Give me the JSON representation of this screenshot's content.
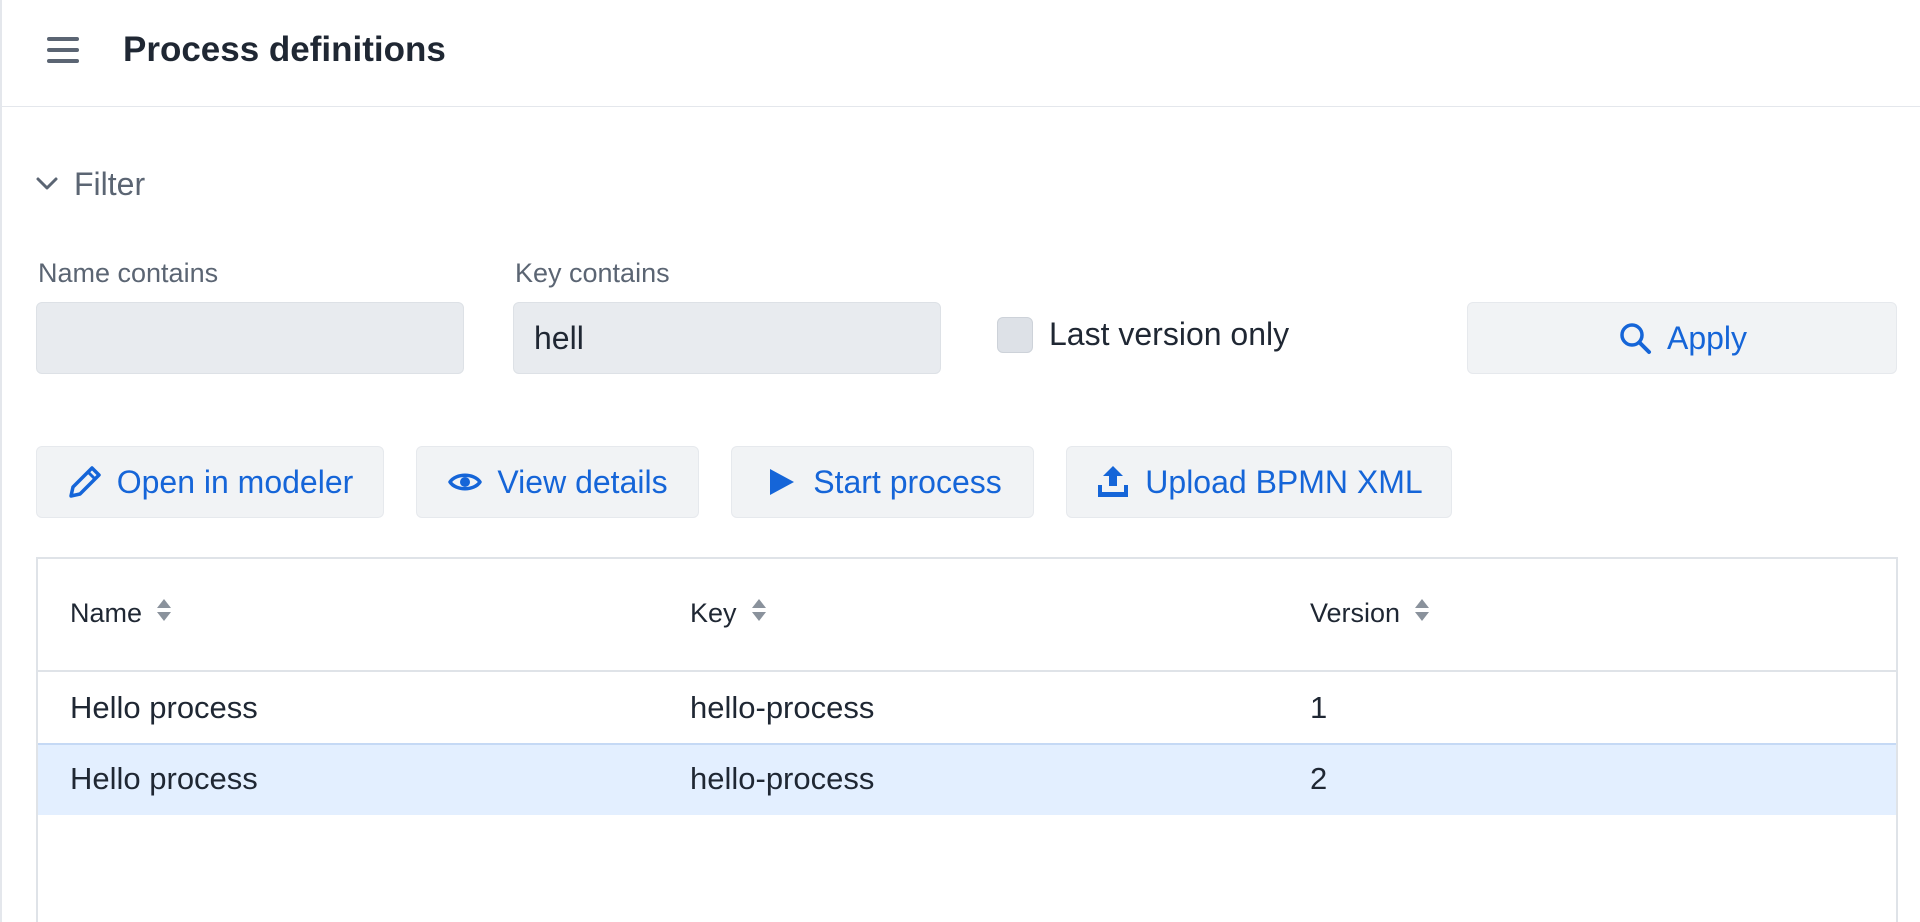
{
  "header": {
    "title": "Process definitions",
    "menu_icon": "hamburger-menu-icon"
  },
  "filter": {
    "toggle_label": "Filter",
    "toggle_icon": "chevron-down-icon",
    "name_label": "Name contains",
    "name_value": "",
    "key_label": "Key contains",
    "key_value": "hell",
    "last_version_label": "Last version only",
    "last_version_checked": false,
    "apply_label": "Apply",
    "apply_icon": "search-icon"
  },
  "toolbar": {
    "open_modeler_label": "Open in modeler",
    "open_modeler_icon": "pencil-icon",
    "view_details_label": "View details",
    "view_details_icon": "eye-icon",
    "start_process_label": "Start process",
    "start_process_icon": "play-icon",
    "upload_label": "Upload BPMN XML",
    "upload_icon": "upload-icon"
  },
  "table": {
    "columns": [
      {
        "label": "Name",
        "sortable": true
      },
      {
        "label": "Key",
        "sortable": true
      },
      {
        "label": "Version",
        "sortable": true
      }
    ],
    "rows": [
      {
        "name": "Hello process",
        "key": "hello-process",
        "version": "1",
        "selected": false
      },
      {
        "name": "Hello process",
        "key": "hello-process",
        "version": "2",
        "selected": true
      }
    ]
  },
  "colors": {
    "accent": "#1565d8",
    "selected_row": "#e3efff",
    "button_bg": "#f1f3f5",
    "input_bg": "#e8ebef",
    "muted_text": "#5b6573"
  }
}
